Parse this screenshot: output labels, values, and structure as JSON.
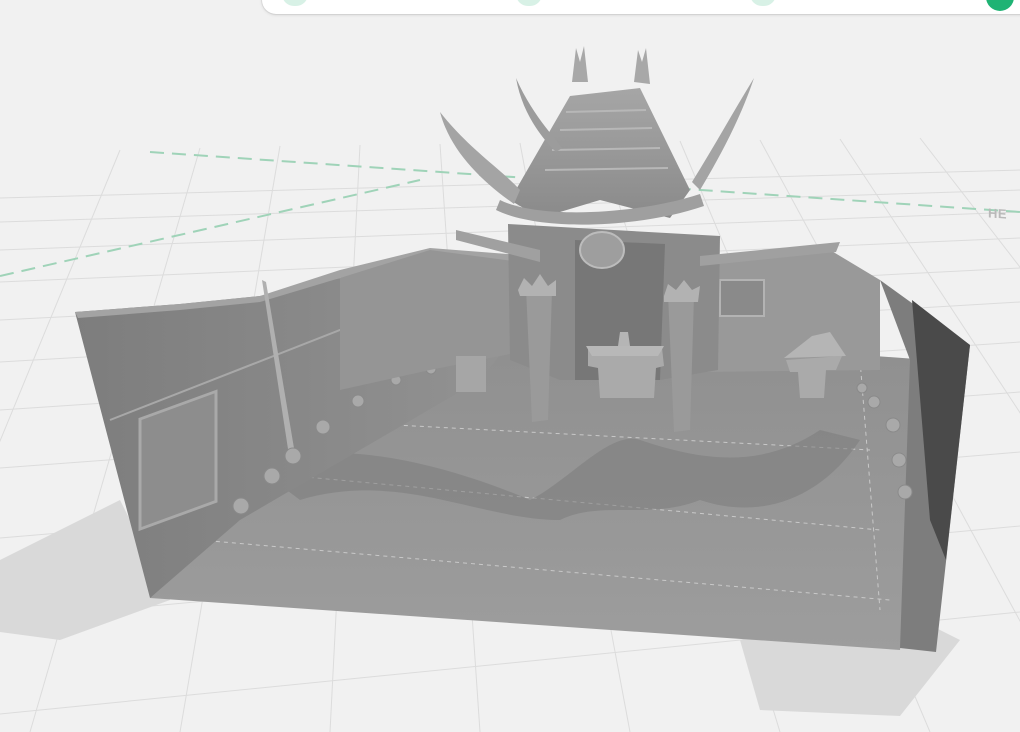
{
  "topbar": {
    "steps": [
      {
        "state": "completed"
      },
      {
        "state": "completed"
      },
      {
        "state": "completed"
      },
      {
        "state": "current"
      }
    ],
    "colors": {
      "completed": "#d8f1e6",
      "current": "#1fb374"
    }
  },
  "viewport": {
    "background": "#f1f1f1",
    "grid_color": "#dcdcdc",
    "axis_color": "#9fd3b8",
    "axis_label": "HE",
    "model_color": "#8c8c8c"
  }
}
